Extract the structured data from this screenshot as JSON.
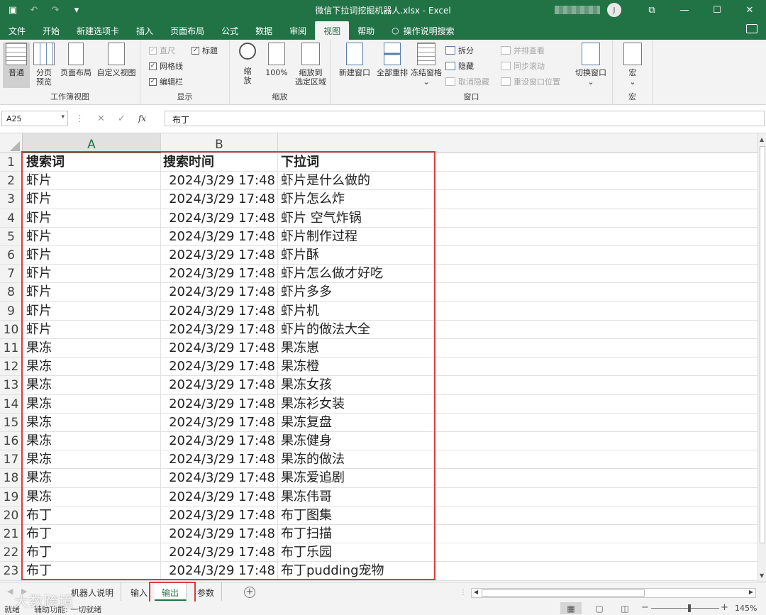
{
  "window": {
    "title": "微信下拉词挖掘机器人.xlsx  -  Excel",
    "user_initial": "J"
  },
  "ribbon_tabs": [
    "文件",
    "开始",
    "新建选项卡",
    "插入",
    "页面布局",
    "公式",
    "数据",
    "审阅",
    "视图",
    "帮助",
    "操作说明搜索"
  ],
  "ribbon": {
    "workbook_views": {
      "label": "工作簿视图",
      "normal": "普通",
      "page_break_1": "分页",
      "page_break_2": "预览",
      "page_layout": "页面布局",
      "custom_view": "自定义视图"
    },
    "show": {
      "label": "显示",
      "ruler": "直尺",
      "gridlines": "网格线",
      "formula_bar": "编辑栏",
      "headings": "标题"
    },
    "zoom": {
      "label": "缩放",
      "zoom_1": "缩",
      "zoom_2": "放",
      "zoom_100": "100%",
      "zoom_sel_1": "缩放到",
      "zoom_sel_2": "选定区域"
    },
    "window": {
      "label": "窗口",
      "new_window": "新建窗口",
      "arrange_all": "全部重排",
      "freeze": "冻结窗格",
      "split": "拆分",
      "hide": "隐藏",
      "unhide": "取消隐藏",
      "side_by_side": "并排查看",
      "sync_scroll": "同步滚动",
      "reset_pos": "重设窗口位置",
      "switch": "切换窗口"
    },
    "macros": {
      "label": "宏",
      "macros": "宏"
    }
  },
  "formula_bar": {
    "name_box": "A25",
    "value": "布丁"
  },
  "columns": [
    "A",
    "B"
  ],
  "header_row": {
    "a": "搜索词",
    "b": "搜索时间",
    "c": "下拉词"
  },
  "rows": [
    {
      "n": "2",
      "a": "虾片",
      "b": "2024/3/29 17:48",
      "c": "虾片是什么做的"
    },
    {
      "n": "3",
      "a": "虾片",
      "b": "2024/3/29 17:48",
      "c": "虾片怎么炸"
    },
    {
      "n": "4",
      "a": "虾片",
      "b": "2024/3/29 17:48",
      "c": "虾片 空气炸锅"
    },
    {
      "n": "5",
      "a": "虾片",
      "b": "2024/3/29 17:48",
      "c": "虾片制作过程"
    },
    {
      "n": "6",
      "a": "虾片",
      "b": "2024/3/29 17:48",
      "c": "虾片酥"
    },
    {
      "n": "7",
      "a": "虾片",
      "b": "2024/3/29 17:48",
      "c": "虾片怎么做才好吃"
    },
    {
      "n": "8",
      "a": "虾片",
      "b": "2024/3/29 17:48",
      "c": "虾片多多"
    },
    {
      "n": "9",
      "a": "虾片",
      "b": "2024/3/29 17:48",
      "c": "虾片机"
    },
    {
      "n": "10",
      "a": "虾片",
      "b": "2024/3/29 17:48",
      "c": "虾片的做法大全"
    },
    {
      "n": "11",
      "a": "果冻",
      "b": "2024/3/29 17:48",
      "c": "果冻崽"
    },
    {
      "n": "12",
      "a": "果冻",
      "b": "2024/3/29 17:48",
      "c": "果冻橙"
    },
    {
      "n": "13",
      "a": "果冻",
      "b": "2024/3/29 17:48",
      "c": "果冻女孩"
    },
    {
      "n": "14",
      "a": "果冻",
      "b": "2024/3/29 17:48",
      "c": "果冻衫女装"
    },
    {
      "n": "15",
      "a": "果冻",
      "b": "2024/3/29 17:48",
      "c": "果冻复盘"
    },
    {
      "n": "16",
      "a": "果冻",
      "b": "2024/3/29 17:48",
      "c": "果冻健身"
    },
    {
      "n": "17",
      "a": "果冻",
      "b": "2024/3/29 17:48",
      "c": "果冻的做法"
    },
    {
      "n": "18",
      "a": "果冻",
      "b": "2024/3/29 17:48",
      "c": "果冻爱追剧"
    },
    {
      "n": "19",
      "a": "果冻",
      "b": "2024/3/29 17:48",
      "c": "果冻伟哥"
    },
    {
      "n": "20",
      "a": "布丁",
      "b": "2024/3/29 17:48",
      "c": "布丁图集"
    },
    {
      "n": "21",
      "a": "布丁",
      "b": "2024/3/29 17:48",
      "c": "布丁扫描"
    },
    {
      "n": "22",
      "a": "布丁",
      "b": "2024/3/29 17:48",
      "c": "布丁乐园"
    },
    {
      "n": "23",
      "a": "布丁",
      "b": "2024/3/29 17:48",
      "c": "布丁pudding宠物"
    }
  ],
  "sheet_tabs": [
    "机器人说明",
    "输入",
    "输出",
    "参数"
  ],
  "active_sheet": "输出",
  "status": {
    "ready": "就绪",
    "accessibility": "辅助功能: 一切就绪",
    "zoom": "145%"
  },
  "watermark": "大数跨境",
  "colors": {
    "excel_green": "#217346",
    "highlight_red": "#e03a3a"
  }
}
